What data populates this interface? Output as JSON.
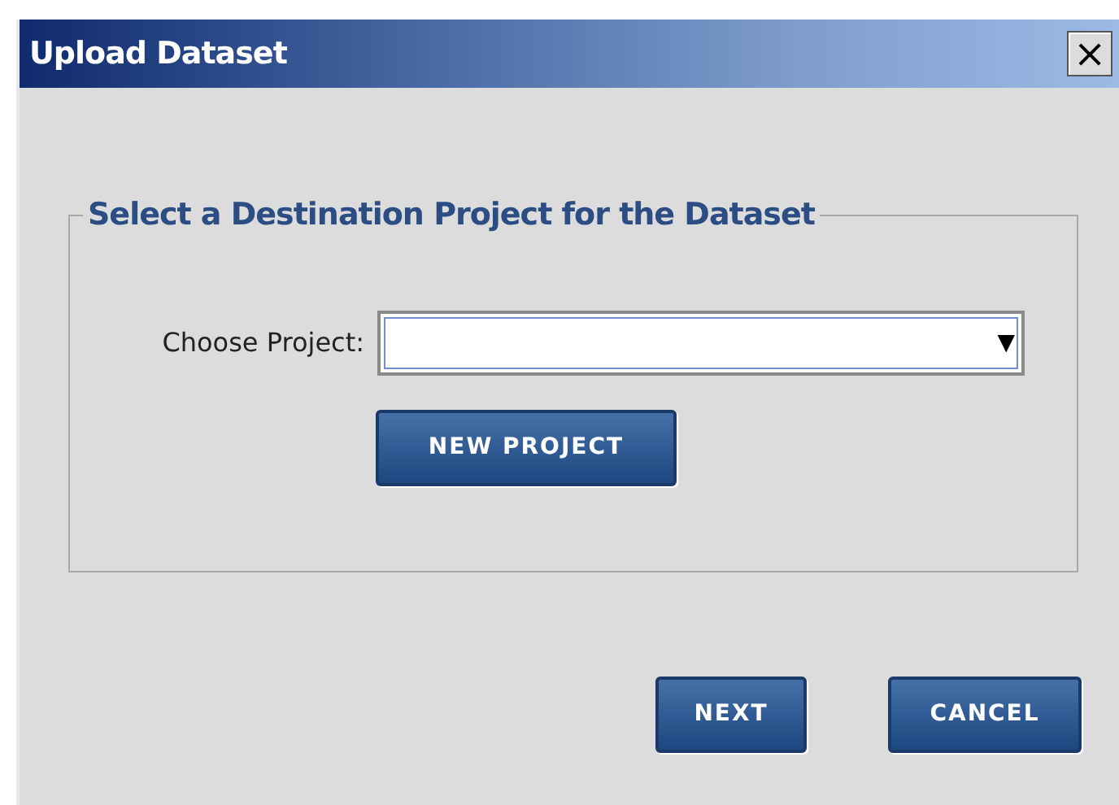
{
  "window": {
    "title": "Upload Dataset",
    "close": "×"
  },
  "group": {
    "legend": "Select a Destination Project for the Dataset",
    "field_label": "Choose Project:",
    "select_arrow": "▼",
    "new_button": "NEW PROJECT"
  },
  "buttons": [
    "NEXT",
    "CANCEL"
  ]
}
